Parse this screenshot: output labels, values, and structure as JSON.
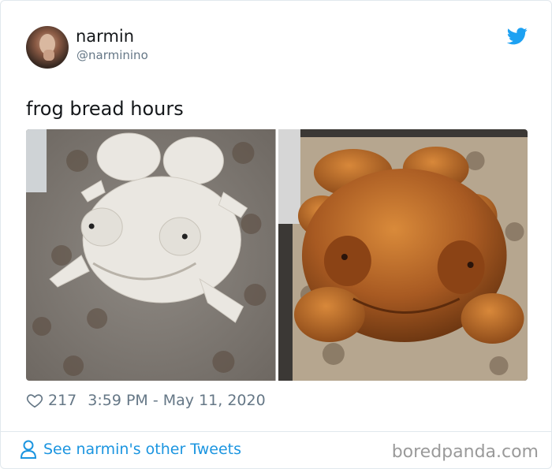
{
  "tweet": {
    "author_name": "narmin",
    "author_handle": "@narminino",
    "text": "frog bread hours",
    "likes": "217",
    "timestamp": "3:59 PM - May 11, 2020"
  },
  "media": [
    {
      "icon": "frog-dough-unbaked-photo"
    },
    {
      "icon": "frog-bread-baked-photo"
    }
  ],
  "footer": {
    "see_more_label": "See narmin's other Tweets"
  },
  "watermark": "boredpanda.com",
  "colors": {
    "twitter_blue": "#1da1f2",
    "link_blue": "#1b95e0",
    "meta_gray": "#657786",
    "text_dark": "#14171a",
    "border": "#e1e8ed"
  },
  "icons": {
    "bird": "twitter-bird-icon",
    "heart": "heart-icon",
    "person": "person-icon"
  }
}
